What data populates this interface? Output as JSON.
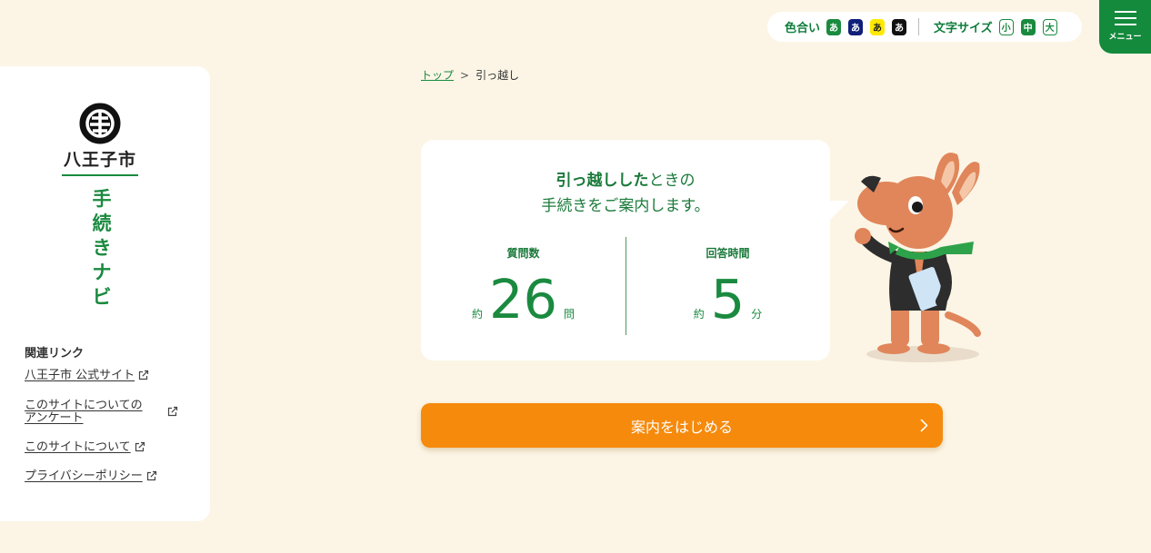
{
  "header": {
    "color_label": "色合い",
    "color_options": [
      "あ",
      "あ",
      "あ",
      "あ"
    ],
    "size_label": "文字サイズ",
    "size_options": [
      "小",
      "中",
      "大"
    ],
    "menu_label": "メニュー"
  },
  "sidebar": {
    "city_name": "八王子市",
    "app_name": [
      "手",
      "続",
      "き",
      "ナ",
      "ビ"
    ],
    "links_heading": "関連リンク",
    "links": [
      {
        "label": "八王子市 公式サイト"
      },
      {
        "label_line1": "このサイトについての",
        "label_line2": "アンケート"
      },
      {
        "label": "このサイトについて"
      },
      {
        "label": "プライバシーポリシー"
      }
    ]
  },
  "breadcrumb": {
    "home": "トップ",
    "separator": ">",
    "current": "引っ越し"
  },
  "card": {
    "headline_bold": "引っ越しした",
    "headline_rest": "ときの",
    "headline_line2": "手続きをご案内します。",
    "stats": [
      {
        "label": "質問数",
        "prefix": "約",
        "value": "26",
        "unit": "問"
      },
      {
        "label": "回答時間",
        "prefix": "約",
        "value": "5",
        "unit": "分"
      }
    ]
  },
  "start_button": {
    "label": "案内をはじめる"
  },
  "colors": {
    "background": "#fcf5e6",
    "brand_green": "#1a8a3f",
    "accent_orange": "#f68a0c"
  },
  "icons": {
    "seal": "city-seal-icon",
    "external": "external-link-icon",
    "menu": "hamburger-icon",
    "chevron": "chevron-right-icon"
  }
}
